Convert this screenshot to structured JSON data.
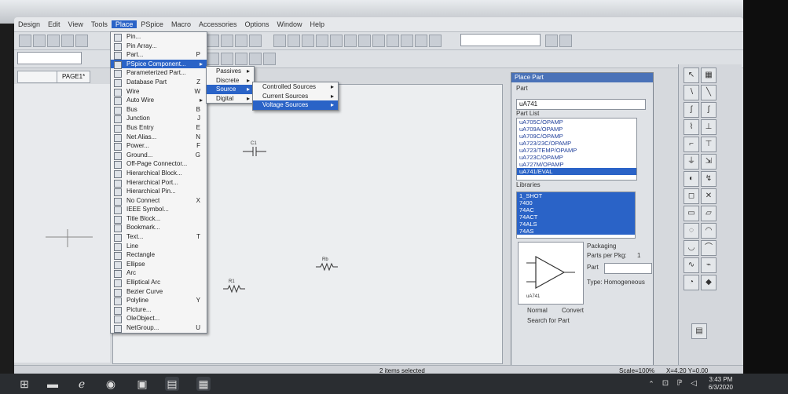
{
  "menubar": {
    "items": [
      "Design",
      "Edit",
      "View",
      "Tools",
      "Place",
      "PSpice",
      "Macro",
      "Accessories",
      "Options",
      "Window",
      "Help"
    ],
    "active": "Place"
  },
  "toolbar": {
    "zoom_value": "",
    "combo_value": ""
  },
  "tabs": {
    "page_tab": "PAGE1*"
  },
  "place_menu": {
    "items": [
      {
        "label": "Pin...",
        "shortcut": "",
        "arrow": false
      },
      {
        "label": "Pin Array...",
        "shortcut": "",
        "arrow": false
      },
      {
        "label": "Part...",
        "shortcut": "P",
        "arrow": false
      },
      {
        "label": "PSpice Component...",
        "shortcut": "",
        "arrow": true,
        "selected": true
      },
      {
        "label": "Parameterized Part...",
        "shortcut": "",
        "arrow": false
      },
      {
        "label": "Database Part",
        "shortcut": "Z",
        "arrow": false
      },
      {
        "label": "Wire",
        "shortcut": "W",
        "arrow": false
      },
      {
        "label": "Auto Wire",
        "shortcut": "",
        "arrow": true
      },
      {
        "label": "Bus",
        "shortcut": "B",
        "arrow": false
      },
      {
        "label": "Junction",
        "shortcut": "J",
        "arrow": false
      },
      {
        "label": "Bus Entry",
        "shortcut": "E",
        "arrow": false
      },
      {
        "label": "Net Alias...",
        "shortcut": "N",
        "arrow": false
      },
      {
        "label": "Power...",
        "shortcut": "F",
        "arrow": false
      },
      {
        "label": "Ground...",
        "shortcut": "G",
        "arrow": false
      },
      {
        "label": "Off-Page Connector...",
        "shortcut": "",
        "arrow": false
      },
      {
        "label": "Hierarchical Block...",
        "shortcut": "",
        "arrow": false
      },
      {
        "label": "Hierarchical Port...",
        "shortcut": "",
        "arrow": false
      },
      {
        "label": "Hierarchical Pin...",
        "shortcut": "",
        "arrow": false
      },
      {
        "label": "No Connect",
        "shortcut": "X",
        "arrow": false
      },
      {
        "label": "IEEE Symbol...",
        "shortcut": "",
        "arrow": false
      },
      {
        "label": "Title Block...",
        "shortcut": "",
        "arrow": false
      },
      {
        "label": "Bookmark...",
        "shortcut": "",
        "arrow": false
      },
      {
        "label": "Text...",
        "shortcut": "T",
        "arrow": false
      },
      {
        "label": "Line",
        "shortcut": "",
        "arrow": false
      },
      {
        "label": "Rectangle",
        "shortcut": "",
        "arrow": false
      },
      {
        "label": "Ellipse",
        "shortcut": "",
        "arrow": false
      },
      {
        "label": "Arc",
        "shortcut": "",
        "arrow": false
      },
      {
        "label": "Elliptical Arc",
        "shortcut": "",
        "arrow": false
      },
      {
        "label": "Bezier Curve",
        "shortcut": "",
        "arrow": false
      },
      {
        "label": "Polyline",
        "shortcut": "Y",
        "arrow": false
      },
      {
        "label": "Picture...",
        "shortcut": "",
        "arrow": false
      },
      {
        "label": "OleObject...",
        "shortcut": "",
        "arrow": false
      },
      {
        "label": "NetGroup...",
        "shortcut": "U",
        "arrow": false
      }
    ]
  },
  "pspice_submenu": {
    "items": [
      {
        "label": "Passives",
        "selected": false
      },
      {
        "label": "Discrete",
        "selected": false
      },
      {
        "label": "Source",
        "selected": true
      },
      {
        "label": "Digital",
        "selected": false
      }
    ]
  },
  "source_submenu": {
    "items": [
      {
        "label": "Controlled Sources",
        "selected": false
      },
      {
        "label": "Current Sources",
        "selected": false
      },
      {
        "label": "Voltage Sources",
        "selected": true
      }
    ]
  },
  "place_part": {
    "title": "Place Part",
    "part_label": "Part",
    "part_value": "uA741",
    "part_list_label": "Part List",
    "part_list": [
      "uA705C/OPAMP",
      "uA709A/OPAMP",
      "uA709C/OPAMP",
      "uA723/23C/OPAMP",
      "uA723/TEMP/OPAMP",
      "uA723C/OPAMP",
      "uA727M/OPAMP",
      "uA741/EVAL"
    ],
    "selected_part": "uA741/EVAL",
    "libraries_label": "Libraries",
    "libraries": [
      "1_SHOT",
      "7400",
      "74AC",
      "74ACT",
      "74ALS",
      "74AS"
    ],
    "packaging_label": "Packaging",
    "parts_per_pkg_label": "Parts per Pkg:",
    "parts_per_pkg_value": "1",
    "part_field_label": "Part",
    "type_label": "Type: Homogeneous",
    "normal_label": "Normal",
    "convert_label": "Convert",
    "search_label": "Search for Part",
    "preview_part_name": "uA741"
  },
  "canvas": {
    "opamp_label": "uA741",
    "cap_label": "C1",
    "res1_label": "R1",
    "res2_label": "Rb"
  },
  "status": {
    "selection": "2 items selected",
    "scale": "Scale=100%",
    "coords": "X=4.20  Y=0.00"
  },
  "taskbar": {
    "time": "3:43 PM",
    "date": "6/3/2020"
  },
  "colors": {
    "selection": "#2a63c7",
    "window_bg": "#d6d9dd",
    "canvas_bg": "#eceef0"
  }
}
